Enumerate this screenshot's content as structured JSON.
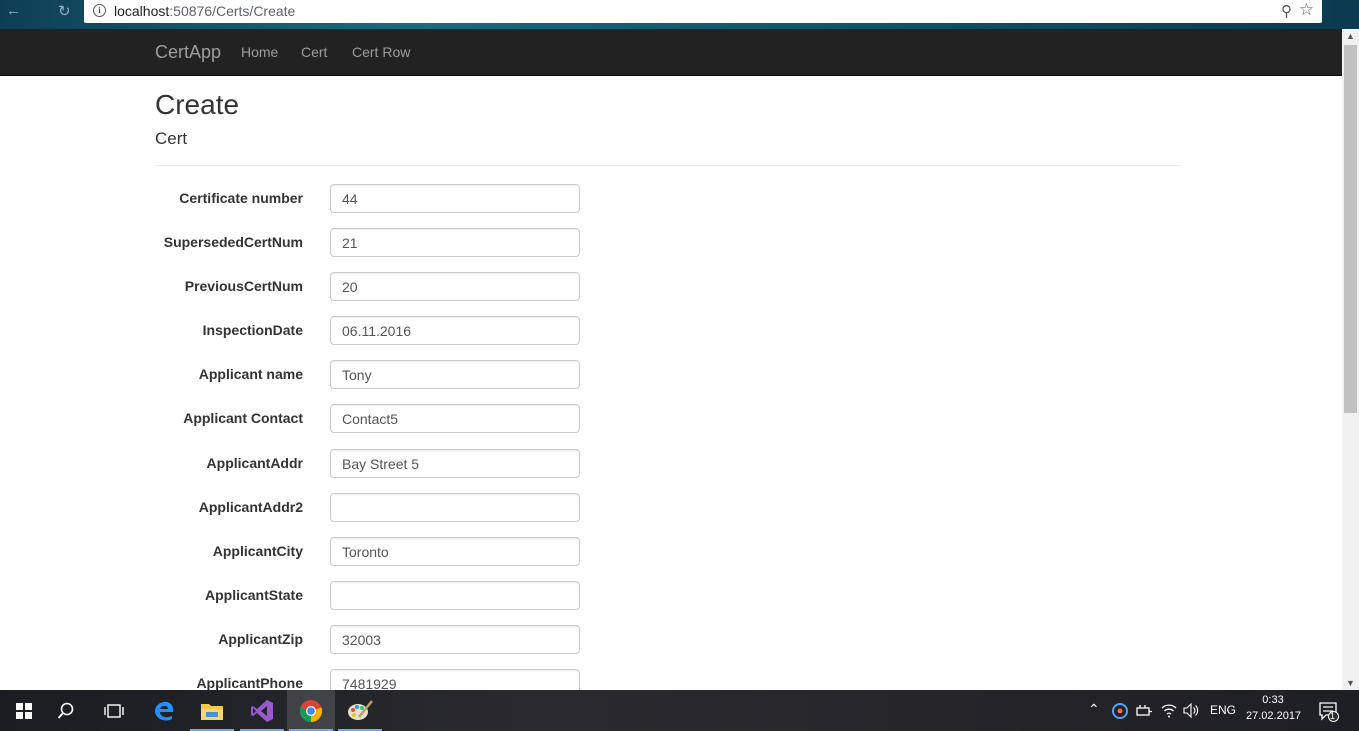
{
  "browser": {
    "url_host": "localhost",
    "url_rest": ":50876/Certs/Create"
  },
  "navbar": {
    "brand": "CertApp",
    "links": [
      "Home",
      "Cert",
      "Cert Row"
    ]
  },
  "page": {
    "title": "Create",
    "subtitle": "Cert"
  },
  "form": {
    "fields": [
      {
        "label": "Certificate number",
        "value": "44"
      },
      {
        "label": "SupersededCertNum",
        "value": "21"
      },
      {
        "label": "PreviousCertNum",
        "value": "20"
      },
      {
        "label": "InspectionDate",
        "value": "06.11.2016"
      },
      {
        "label": "Applicant name",
        "value": "Tony"
      },
      {
        "label": "Applicant Contact",
        "value": "Contact5"
      },
      {
        "label": "ApplicantAddr",
        "value": "Bay Street 5"
      },
      {
        "label": "ApplicantAddr2",
        "value": ""
      },
      {
        "label": "ApplicantCity",
        "value": "Toronto"
      },
      {
        "label": "ApplicantState",
        "value": ""
      },
      {
        "label": "ApplicantZip",
        "value": "32003"
      },
      {
        "label": "ApplicantPhone",
        "value": "7481929"
      }
    ]
  },
  "taskbar": {
    "language": "ENG",
    "time": "0:33",
    "date": "27.02.2017",
    "notification_count": "1"
  }
}
